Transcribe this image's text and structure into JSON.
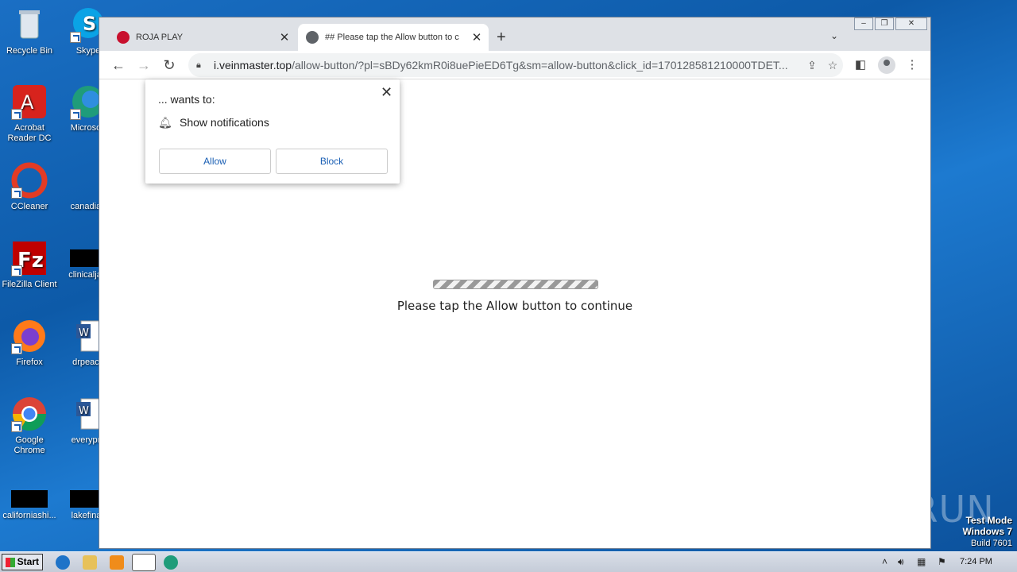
{
  "desktop": {
    "icons": [
      {
        "label": "Recycle Bin"
      },
      {
        "label": "Skype"
      },
      {
        "label": "Acrobat Reader DC"
      },
      {
        "label": "Microsoft"
      },
      {
        "label": "CCleaner"
      },
      {
        "label": "canadian"
      },
      {
        "label": "FileZilla Client"
      },
      {
        "label": "clinicaljacl"
      },
      {
        "label": "Firefox"
      },
      {
        "label": "drpeace"
      },
      {
        "label": "Google Chrome"
      },
      {
        "label": "everypre"
      },
      {
        "label": "californiashi..."
      },
      {
        "label": "lakefinall"
      }
    ],
    "watermark": {
      "line1": "Test Mode",
      "line2": "Windows 7",
      "line3": "Build 7601"
    },
    "anyrun": "ANY RUN"
  },
  "browser": {
    "tabs": [
      {
        "title": "ROJA PLAY",
        "active": false
      },
      {
        "title": "## Please tap the Allow button to c",
        "active": true
      }
    ],
    "address": {
      "host": "i.veinmaster.top",
      "path": "/allow-button/?pl=sBDy62kmR0i8uePieED6Tg&sm=allow-button&click_id=170128581210000TDET..."
    },
    "popup": {
      "wants": "... wants to:",
      "permission": "Show notifications",
      "allow": "Allow",
      "block": "Block"
    },
    "page": {
      "message": "Please tap the Allow button to continue"
    }
  },
  "taskbar": {
    "start": "Start",
    "clock": "7:24 PM"
  },
  "colors": {
    "accent": "#1a5fb4",
    "desktop": "#1a6fc4",
    "tabstrip": "#dee1e6"
  }
}
